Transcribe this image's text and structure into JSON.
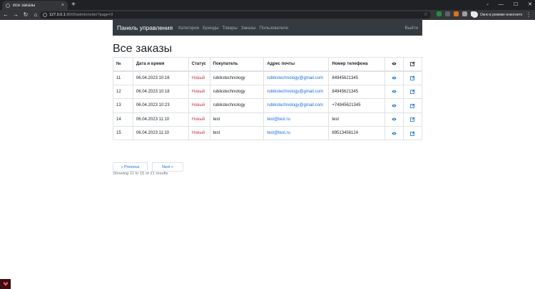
{
  "browser": {
    "tab_title": "Все заказы",
    "tab_close": "×",
    "new_tab": "+",
    "url_host": "127.0.0.1",
    "url_path": ":8000/admin/order?page=3",
    "profile_label": "Окно в режиме инкогнито",
    "window_controls": [
      "—",
      "☐",
      "✕"
    ]
  },
  "navbar": {
    "brand": "Панель управления",
    "links": [
      "Категории",
      "Бренды",
      "Товары",
      "Заказы",
      "Пользователи"
    ],
    "logout": "Выйти"
  },
  "page": {
    "title": "Все заказы"
  },
  "table": {
    "headers": [
      "№",
      "Дата и время",
      "Статус",
      "Покупатель",
      "Адрес почты",
      "Номер телефона"
    ],
    "rows": [
      {
        "id": "11",
        "datetime": "06.04.2023 10:16",
        "status": "Новый",
        "customer": "rubikstechnology",
        "email": "rubikstechnology@gmail.com",
        "phone": "84945621345"
      },
      {
        "id": "12",
        "datetime": "06.04.2023 10:18",
        "status": "Новый",
        "customer": "rubikstechnology",
        "email": "rubikstechnology@gmail.com",
        "phone": "84945621345"
      },
      {
        "id": "13",
        "datetime": "06.04.2023 10:23",
        "status": "Новый",
        "customer": "rubikstechnology",
        "email": "rubikstechnology@gmail.com",
        "phone": "+74945621345"
      },
      {
        "id": "14",
        "datetime": "06.04.2023 11:10",
        "status": "Новый",
        "customer": "test",
        "email": "test@test.ru",
        "phone": "test"
      },
      {
        "id": "15",
        "datetime": "06.04.2023 11:10",
        "status": "Новый",
        "customer": "test",
        "email": "test@test.ru",
        "phone": "89513456124"
      }
    ]
  },
  "pagination": {
    "previous": "« Previous",
    "next": "Next »",
    "summary": "Showing 11 to 15 of 21 results"
  },
  "icons": {
    "view": "eye-icon",
    "edit": "edit-icon"
  },
  "colors": {
    "navbar_bg": "#343a40",
    "link": "#0d6efd",
    "status_new": "#dc3545"
  }
}
